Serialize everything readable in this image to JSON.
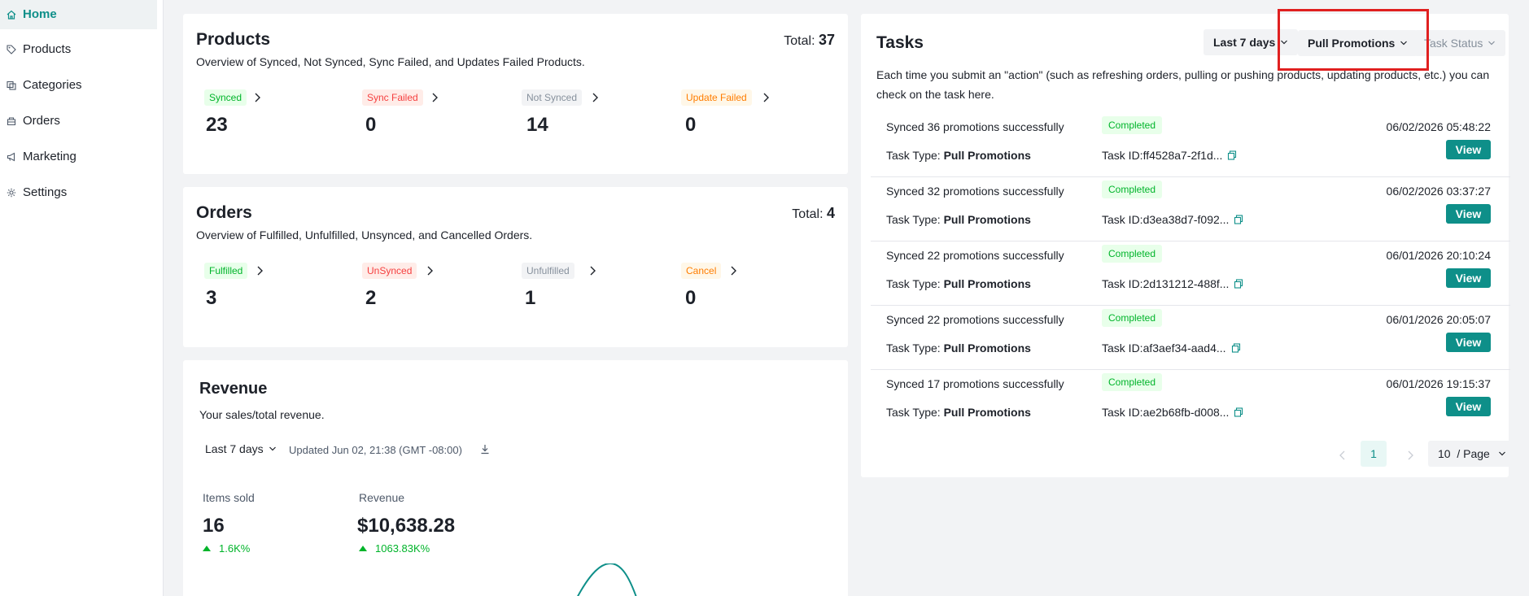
{
  "sidebar": {
    "items": [
      {
        "label": "Home",
        "icon": "home-icon",
        "active": true
      },
      {
        "label": "Products",
        "icon": "tag-icon"
      },
      {
        "label": "Categories",
        "icon": "categories-icon"
      },
      {
        "label": "Orders",
        "icon": "orders-icon"
      },
      {
        "label": "Marketing",
        "icon": "megaphone-icon"
      },
      {
        "label": "Settings",
        "icon": "gear-icon"
      }
    ]
  },
  "products": {
    "title": "Products",
    "total_label": "Total: ",
    "total": "37",
    "subtitle": "Overview of Synced, Not Synced, Sync Failed, and Updates Failed Products.",
    "stats": [
      {
        "label": "Synced",
        "value": "23"
      },
      {
        "label": "Sync Failed",
        "value": "0"
      },
      {
        "label": "Not Synced",
        "value": "14"
      },
      {
        "label": "Update Failed",
        "value": "0"
      }
    ]
  },
  "orders": {
    "title": "Orders",
    "total_label": "Total: ",
    "total": "4",
    "subtitle": "Overview of Fulfilled, Unfulfilled, Unsynced, and Cancelled Orders.",
    "stats": [
      {
        "label": "Fulfilled",
        "value": "3"
      },
      {
        "label": "UnSynced",
        "value": "2"
      },
      {
        "label": "Unfulfilled",
        "value": "1"
      },
      {
        "label": "Cancel",
        "value": "0"
      }
    ]
  },
  "revenue": {
    "title": "Revenue",
    "subtitle": "Your sales/total revenue.",
    "range": "Last 7 days",
    "updated": "Updated Jun 02, 21:38 (GMT -08:00)",
    "items_sold_label": "Items sold",
    "items_sold": "16",
    "items_sold_delta": "1.6K%",
    "revenue_label": "Revenue",
    "revenue_value": "$10,638.28",
    "revenue_delta": "1063.83K%"
  },
  "tasks": {
    "title": "Tasks",
    "filter_range": "Last 7 days",
    "filter_type": "Pull Promotions",
    "filter_status_placeholder": "Task Status",
    "description": "Each time you submit an \"action\" (such as refreshing orders, pulling or pushing products, updating products, etc.) you can check on the task here.",
    "type_label": "Task Type: ",
    "id_label": "Task ID: ",
    "view_label": "View",
    "rows": [
      {
        "message": "Synced 36 promotions successfully",
        "status": "Completed",
        "time": "06/02/2026 05:48:22",
        "type": "Pull Promotions",
        "id": "ff4528a7-2f1d..."
      },
      {
        "message": "Synced 32 promotions successfully",
        "status": "Completed",
        "time": "06/02/2026 03:37:27",
        "type": "Pull Promotions",
        "id": "d3ea38d7-f092..."
      },
      {
        "message": "Synced 22 promotions successfully",
        "status": "Completed",
        "time": "06/01/2026 20:10:24",
        "type": "Pull Promotions",
        "id": "2d131212-488f..."
      },
      {
        "message": "Synced 22 promotions successfully",
        "status": "Completed",
        "time": "06/01/2026 20:05:07",
        "type": "Pull Promotions",
        "id": "af3aef34-aad4..."
      },
      {
        "message": "Synced 17 promotions successfully",
        "status": "Completed",
        "time": "06/01/2026 19:15:37",
        "type": "Pull Promotions",
        "id": "ae2b68fb-d008..."
      }
    ],
    "pagination": {
      "current_page": "1",
      "page_size": "10  / Page"
    }
  }
}
